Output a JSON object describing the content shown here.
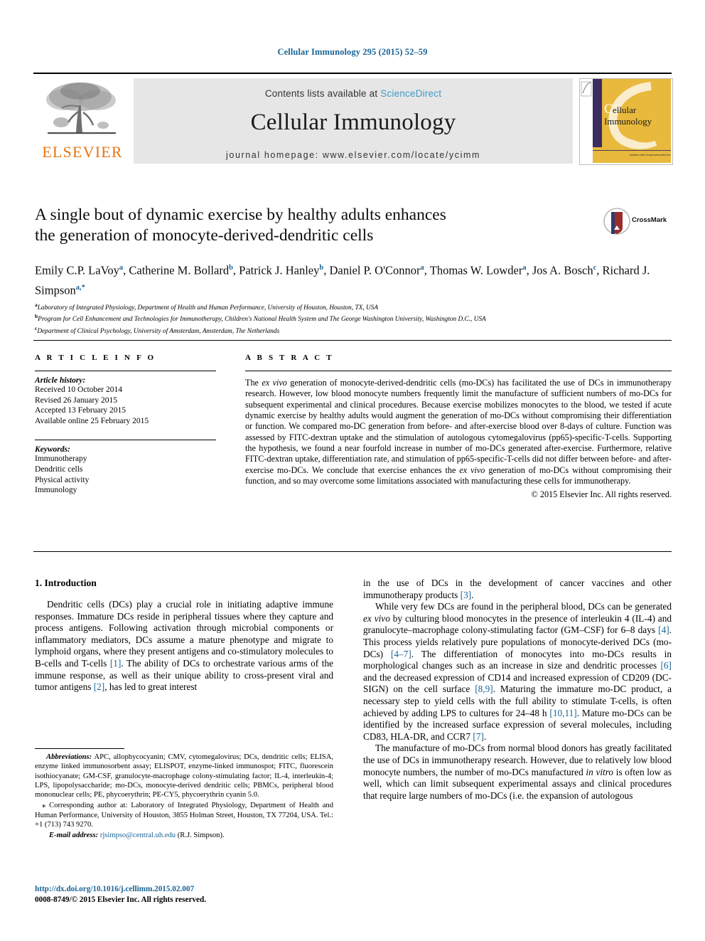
{
  "running_head": "Cellular Immunology 295 (2015) 52–59",
  "masthead": {
    "publisher_logo_text": "ELSEVIER",
    "contents_prefix": "Contents lists available at",
    "contents_link": "ScienceDirect",
    "journal_name": "Cellular Immunology",
    "homepage_line": "journal homepage: www.elsevier.com/locate/ycimm",
    "cover_title_line1": "ellular",
    "cover_title_line2": "Immunology",
    "cover_footer": "available online at www.sciencedirect.com",
    "cover_initial": "C"
  },
  "article": {
    "title_line1": "A single bout of dynamic exercise by healthy adults enhances",
    "title_line2": "the generation of monocyte-derived-dendritic cells",
    "crossmark_label": "CrossMark",
    "authors": [
      {
        "name": "Emily C.P. LaVoy",
        "marks": "a",
        "sep": ", "
      },
      {
        "name": "Catherine M. Bollard",
        "marks": "b",
        "sep": ", "
      },
      {
        "name": "Patrick J. Hanley",
        "marks": "b",
        "sep": ", "
      },
      {
        "name": "Daniel P. O'Connor",
        "marks": "a",
        "sep": ", "
      },
      {
        "name": "Thomas W. Lowder",
        "marks": "a",
        "sep": ", "
      },
      {
        "name": "Jos A. Bosch",
        "marks": "c",
        "sep": ", "
      },
      {
        "name": "Richard J. Simpson",
        "marks": "a,*",
        "sep": ""
      }
    ],
    "affiliations": [
      {
        "mark": "a",
        "text": "Laboratory of Integrated Physiology, Department of Health and Human Performance, University of Houston, Houston, TX, USA"
      },
      {
        "mark": "b",
        "text": "Program for Cell Enhancement and Technologies for Immunotherapy, Children's National Health System and The George Washington University, Washington D.C., USA"
      },
      {
        "mark": "c",
        "text": "Department of Clinical Psychology, University of Amsterdam, Amsterdam, The Netherlands"
      }
    ]
  },
  "article_info": {
    "heading": "A R T I C L E    I N F O",
    "history_label": "Article history:",
    "history": [
      "Received 10 October 2014",
      "Revised 26 January 2015",
      "Accepted 13 February 2015",
      "Available online 25 February 2015"
    ],
    "keywords_label": "Keywords:",
    "keywords": [
      "Immunotherapy",
      "Dendritic cells",
      "Physical activity",
      "Immunology"
    ]
  },
  "abstract": {
    "heading": "A B S T R A C T",
    "lead_italic": "ex vivo",
    "body_part1": "The ",
    "body_part2": " generation of monocyte-derived-dendritic cells (mo-DCs) has facilitated the use of DCs in immunotherapy research. However, low blood monocyte numbers frequently limit the manufacture of sufficient numbers of mo-DCs for subsequent experimental and clinical procedures. Because exercise mobilizes monocytes to the blood, we tested if acute dynamic exercise by healthy adults would augment the generation of mo-DCs without compromising their differentiation or function. We compared mo-DC generation from before- and after-exercise blood over 8-days of culture. Function was assessed by FITC-dextran uptake and the stimulation of autologous cytomegalovirus (pp65)-specific-T-cells. Supporting the hypothesis, we found a near fourfold increase in number of mo-DCs generated after-exercise. Furthermore, relative FITC-dextran uptake, differentiation rate, and stimulation of pp65-specific-T-cells did not differ between before- and after-exercise mo-DCs. We conclude that exercise enhances the ",
    "body_part3": " generation of mo-DCs without compromising their function, and so may overcome some limitations associated with manufacturing these cells for immunotherapy.",
    "copyright": "© 2015 Elsevier Inc. All rights reserved."
  },
  "intro": {
    "heading": "1. Introduction",
    "left_p1_a": "Dendritic cells (DCs) play a crucial role in initiating adaptive immune responses. Immature DCs reside in peripheral tissues where they capture and process antigens. Following activation through microbial components or inflammatory mediators, DCs assume a mature phenotype and migrate to lymphoid organs, where they present antigens and co-stimulatory molecules to B-cells and T-cells ",
    "left_ref1": "[1]",
    "left_p1_b": ". The ability of DCs to orchestrate various arms of the immune response, as well as their unique ability to cross-present viral and tumor antigens ",
    "left_ref2": "[2]",
    "left_p1_c": ", has led to great interest",
    "right_p1_a": "in the use of DCs in the development of cancer vaccines and other immunotherapy products ",
    "right_ref3": "[3]",
    "right_p1_b": ".",
    "right_p2_a": "While very few DCs are found in the peripheral blood, DCs can be generated ",
    "right_italic1": "ex vivo",
    "right_p2_b": " by culturing blood monocytes in the presence of interleukin 4 (IL-4) and granulocyte–macrophage colony-stimulating factor (GM–CSF) for 6–8 days ",
    "right_ref4": "[4]",
    "right_p2_c": ". This process yields relatively pure populations of monocyte-derived DCs (mo-DCs) ",
    "right_ref5": "[4–7]",
    "right_p2_d": ". The differentiation of monocytes into mo-DCs results in morphological changes such as an increase in size and dendritic processes ",
    "right_ref6": "[6]",
    "right_p2_e": " and the decreased expression of CD14 and increased expression of CD209 (DC-SIGN) on the cell surface ",
    "right_ref7": "[8,9]",
    "right_p2_f": ". Maturing the immature mo-DC product, a necessary step to yield cells with the full ability to stimulate T-cells, is often achieved by adding LPS to cultures for 24–48 h ",
    "right_ref8": "[10,11]",
    "right_p2_g": ". Mature mo-DCs can be identified by the increased surface expression of several molecules, including CD83, HLA-DR, and CCR7 ",
    "right_ref9": "[7]",
    "right_p2_h": ".",
    "right_p3_a": "The manufacture of mo-DCs from normal blood donors has greatly facilitated the use of DCs in immunotherapy research. However, due to relatively low blood monocyte numbers, the number of mo-DCs manufactured ",
    "right_italic2": "in vitro",
    "right_p3_b": " is often low as well, which can limit subsequent experimental assays and clinical procedures that require large numbers of mo-DCs (i.e. the expansion of autologous"
  },
  "footnotes": {
    "abbrev_label": "Abbreviations:",
    "abbrev_text": " APC, allophycocyanin; CMV, cytomegalovirus; DCs, dendritic cells; ELISA, enzyme linked immunosorbent assay; ELISPOT, enzyme-linked immunospot; FITC, fluorescein isothiocyanate; GM-CSF, granulocyte-macrophage colony-stimulating factor; IL-4, interleukin-4; LPS, lipopolysaccharide; mo-DCs, monocyte-derived dendritic cells; PBMCs, peripheral blood mononuclear cells; PE, phycoerythrin; PE-CY5, phycoerythrin cyanin 5.0.",
    "corresponding_marker": "⁎",
    "corresponding_text": " Corresponding author at: Laboratory of Integrated Physiology, Department of Health and Human Performance, University of Houston, 3855 Holman Street, Houston, TX 77204, USA. Tel.: +1 (713) 743 9270.",
    "email_label": "E-mail address:",
    "email_value": "rjsimpso@central.uh.edu",
    "email_suffix": " (R.J. Simpson).",
    "doi": "http://dx.doi.org/10.1016/j.cellimm.2015.02.007",
    "issn_line_a": "0008-8749/",
    "issn_line_b": "© 2015 Elsevier Inc. All rights reserved."
  },
  "colors": {
    "link": "#1a6496",
    "sciencedirect": "#3f9bc8",
    "elsevier_orange": "#e87511",
    "band_gray": "#e6e6e6",
    "cover_gold": "#e8b93c",
    "cover_purple": "#3b2c62",
    "crossmark_red": "#9b2c2c"
  }
}
